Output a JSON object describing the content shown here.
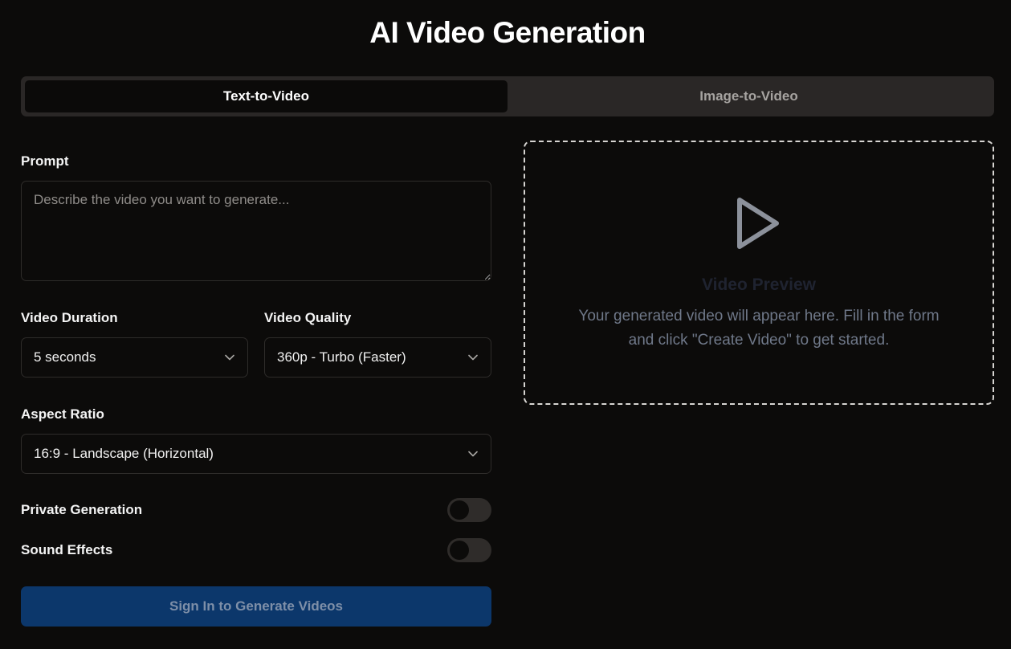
{
  "page": {
    "title": "AI Video Generation"
  },
  "tabs": [
    {
      "label": "Text-to-Video",
      "active": true
    },
    {
      "label": "Image-to-Video",
      "active": false
    }
  ],
  "form": {
    "prompt": {
      "label": "Prompt",
      "placeholder": "Describe the video you want to generate...",
      "value": ""
    },
    "duration": {
      "label": "Video Duration",
      "value": "5 seconds",
      "icon": "chevron-down-icon"
    },
    "quality": {
      "label": "Video Quality",
      "value": "360p - Turbo (Faster)",
      "icon": "chevron-down-icon"
    },
    "aspect_ratio": {
      "label": "Aspect Ratio",
      "value": "16:9 - Landscape (Horizontal)",
      "icon": "chevron-down-icon"
    },
    "private_generation": {
      "label": "Private Generation",
      "enabled": false
    },
    "sound_effects": {
      "label": "Sound Effects",
      "enabled": false
    },
    "submit_label": "Sign In to Generate Videos"
  },
  "preview": {
    "icon": "play-icon",
    "title": "Video Preview",
    "description": "Your generated video will appear here. Fill in the form and click \"Create Video\" to get started."
  },
  "colors": {
    "background": "#0c0b0a",
    "tab_track": "#2a2726",
    "submit_button": "#0c376b",
    "submit_text": "#7e8fa8",
    "preview_border": "#d7d5d2",
    "preview_text": "#6f7889"
  }
}
